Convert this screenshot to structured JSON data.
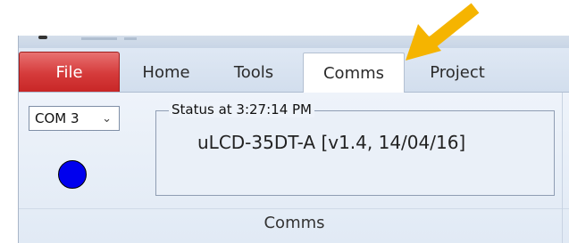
{
  "tabs": [
    "File",
    "Home",
    "Tools",
    "Comms",
    "Project"
  ],
  "active_tab": "Comms",
  "com_port": {
    "selected": "COM 3"
  },
  "connection_status_color": "#0000ee",
  "status": {
    "legend": "Status at 3:27:14 PM",
    "device": "uLCD-35DT-A [v1.4, 14/04/16]"
  },
  "group_label": "Comms",
  "colors": {
    "file_tab": "#d53a3a",
    "annotation_arrow": "#f5b400"
  },
  "annotation": {
    "icon": "arrow-pointer-icon",
    "target": "Project"
  }
}
